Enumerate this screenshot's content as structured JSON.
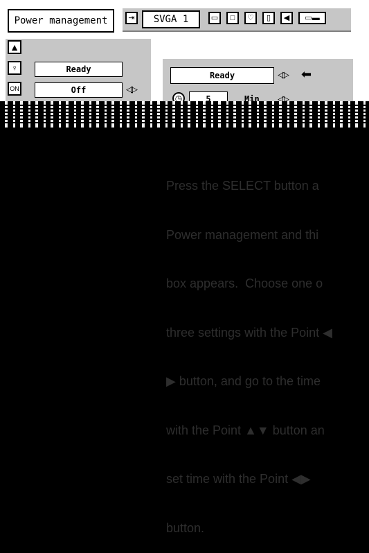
{
  "header": {
    "title": "Power management",
    "mode_label": "SVGA 1"
  },
  "menu_icons": [
    "input-icon",
    "image-icon",
    "screen-icon",
    "color-icon",
    "settings-icon",
    "sound-icon",
    "power-icon"
  ],
  "left_panel": {
    "status_value": "Ready",
    "power_off_value": "Off"
  },
  "right_panel": {
    "mode_value": "Ready",
    "timer_value": "5",
    "timer_unit": "Min"
  },
  "instruction_lines": [
    "Press the SELECT button a",
    "Power management and thi",
    "box appears.  Choose one o",
    "three settings with the Point ◀",
    "▶ button, and go to the time",
    "with the Point ▲▼ button an",
    "set time with the Point ◀▶",
    "button."
  ],
  "colors": {
    "panel_gray": "#c6c6c6",
    "text_dim": "#2e2e2e"
  }
}
